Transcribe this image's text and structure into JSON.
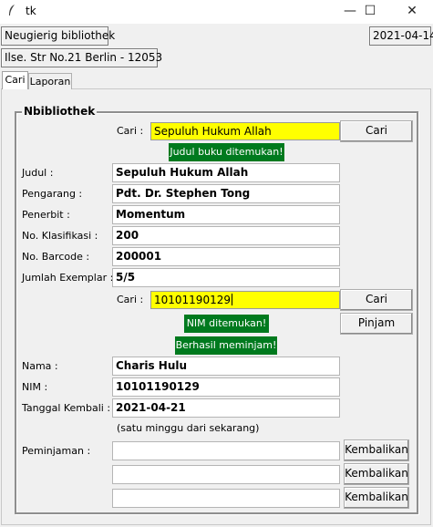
{
  "window": {
    "title": "tk",
    "icon": "feather-icon",
    "controls": [
      "—",
      "☐",
      "✕"
    ]
  },
  "header": {
    "library_name": "Neugierig bibliothek",
    "address": "Ilse. Str No.21 Berlin - 12053",
    "date": "2021-04-14"
  },
  "tabs": [
    {
      "label": "Cari",
      "active": true
    },
    {
      "label": "Laporan",
      "active": false
    }
  ],
  "frame": {
    "title": "Nbibliothek"
  },
  "book_search": {
    "label": "Cari :",
    "value": "Sepuluh Hukum Allah",
    "button": "Cari",
    "status": "Judul buku ditemukan!"
  },
  "book": {
    "fields": [
      {
        "label": "Judul :",
        "value": "Sepuluh Hukum Allah"
      },
      {
        "label": "Pengarang :",
        "value": "Pdt. Dr. Stephen Tong"
      },
      {
        "label": "Penerbit :",
        "value": "Momentum"
      },
      {
        "label": "No. Klasifikasi :",
        "value": "200"
      },
      {
        "label": "No. Barcode :",
        "value": "200001"
      },
      {
        "label": "Jumlah Exemplar :",
        "value": "5/5"
      }
    ]
  },
  "member_search": {
    "label": "Cari :",
    "value": "10101190129",
    "button": "Cari",
    "borrow_button": "Pinjam",
    "status_found": "NIM ditemukan!",
    "status_borrowed": "Berhasil meminjam!"
  },
  "member": {
    "fields": [
      {
        "label": "Nama :",
        "value": "Charis Hulu"
      },
      {
        "label": "NIM :",
        "value": "10101190129"
      },
      {
        "label": "Tanggal Kembali :",
        "value": "2021-04-21"
      }
    ],
    "return_note": "(satu minggu dari sekarang)"
  },
  "loans": {
    "label": "Peminjaman :",
    "rows": [
      {
        "value": "",
        "button": "Kembalikan"
      },
      {
        "value": "",
        "button": "Kembalikan"
      },
      {
        "value": "",
        "button": "Kembalikan"
      }
    ]
  },
  "colors": {
    "highlight": "#ffff00",
    "status_green": "#007a1e"
  }
}
